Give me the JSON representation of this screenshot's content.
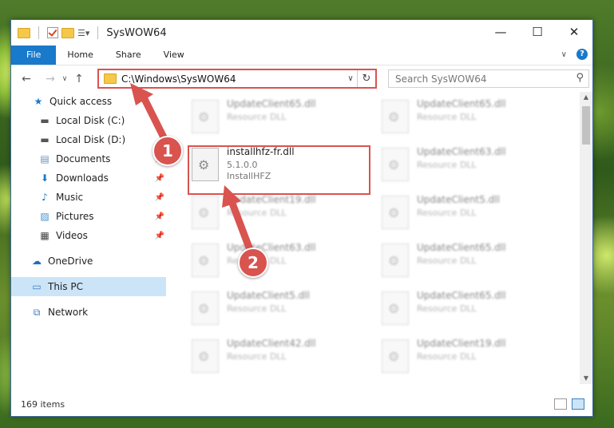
{
  "window": {
    "title": "SysWOW64",
    "controls": {
      "minimize": "—",
      "maximize": "☐",
      "close": "✕"
    }
  },
  "ribbon": {
    "tabs": [
      "File",
      "Home",
      "Share",
      "View"
    ],
    "help": "?"
  },
  "nav": {
    "address": "C:\\Windows\\SysWOW64",
    "search_placeholder": "Search SysWOW64"
  },
  "sidebar": {
    "items": [
      {
        "label": "Quick access",
        "icon": "star-icon",
        "pinned": false
      },
      {
        "label": "Local Disk (C:)",
        "icon": "drive-icon",
        "pinned": false
      },
      {
        "label": "Local Disk (D:)",
        "icon": "drive-icon",
        "pinned": false
      },
      {
        "label": "Documents",
        "icon": "documents-icon",
        "pinned": true
      },
      {
        "label": "Downloads",
        "icon": "download-icon",
        "pinned": true
      },
      {
        "label": "Music",
        "icon": "music-icon",
        "pinned": true
      },
      {
        "label": "Pictures",
        "icon": "pictures-icon",
        "pinned": true
      },
      {
        "label": "Videos",
        "icon": "videos-icon",
        "pinned": true
      },
      {
        "label": "OneDrive",
        "icon": "cloud-icon",
        "pinned": false
      },
      {
        "label": "This PC",
        "icon": "computer-icon",
        "pinned": false
      },
      {
        "label": "Network",
        "icon": "network-icon",
        "pinned": false
      }
    ]
  },
  "files": [
    {
      "name": "UpdateClient65.dll",
      "sub": "Resource DLL",
      "blurred": true
    },
    {
      "name": "UpdateClient65.dll",
      "sub": "Resource DLL",
      "blurred": true
    },
    {
      "name": "installhfz-fr.dll",
      "sub": "5.1.0.0",
      "sub2": "InstallHFZ",
      "blurred": false
    },
    {
      "name": "UpdateClient63.dll",
      "sub": "Resource DLL",
      "blurred": true
    },
    {
      "name": "UpdateClient19.dll",
      "sub": "Resource DLL",
      "blurred": true
    },
    {
      "name": "UpdateClient5.dll",
      "sub": "Resource DLL",
      "blurred": true
    },
    {
      "name": "UpdateClient63.dll",
      "sub": "Resource DLL",
      "blurred": true
    },
    {
      "name": "UpdateClient65.dll",
      "sub": "Resource DLL",
      "blurred": true
    },
    {
      "name": "UpdateClient5.dll",
      "sub": "Resource DLL",
      "blurred": true
    },
    {
      "name": "UpdateClient65.dll",
      "sub": "Resource DLL",
      "blurred": true
    },
    {
      "name": "UpdateClient42.dll",
      "sub": "Resource DLL",
      "blurred": true
    },
    {
      "name": "UpdateClient19.dll",
      "sub": "Resource DLL",
      "blurred": true
    }
  ],
  "status": {
    "item_count": "169 items"
  },
  "annotations": [
    {
      "number": "1",
      "color": "#d9534f"
    },
    {
      "number": "2",
      "color": "#d9534f"
    }
  ]
}
